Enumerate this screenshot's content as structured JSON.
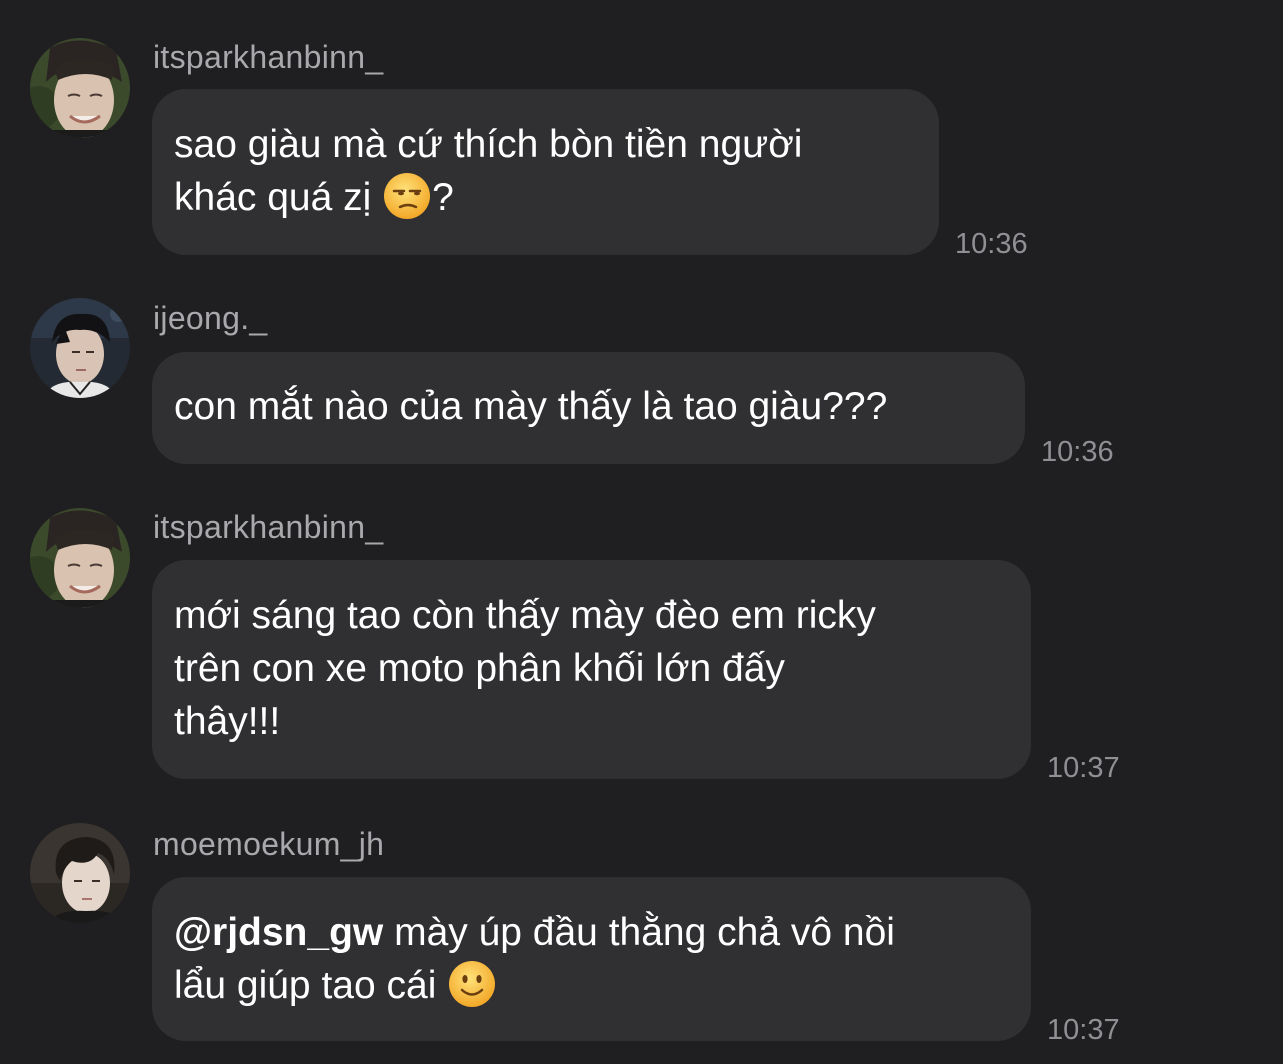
{
  "messages": [
    {
      "username": "itsparkhanbinn_",
      "avatar_icon": "profile-photo-man-smiling-icon",
      "text_lines": [
        "sao giàu mà cứ thích bòn tiền người",
        "khác quá zị"
      ],
      "text_suffix": "?",
      "emoji": "unamused-face-emoji",
      "time": "10:36"
    },
    {
      "username": "ijeong._",
      "avatar_icon": "profile-photo-man-dark-hair-icon",
      "text_lines": [
        "con mắt nào của mày thấy là tao giàu???"
      ],
      "time": "10:36"
    },
    {
      "username": "itsparkhanbinn_",
      "avatar_icon": "profile-photo-man-smiling-icon",
      "text_lines": [
        "mới sáng tao còn thấy mày đèo em ricky",
        "trên con xe moto phân khối lớn đấy",
        "thây!!!"
      ],
      "time": "10:37"
    },
    {
      "username": "moemoekum_jh",
      "avatar_icon": "profile-photo-man-tousled-hair-icon",
      "mention": "@rjdsn_gw",
      "text_lines": [
        "mày úp đầu thằng chả vô nồi",
        "lẩu giúp tao cái"
      ],
      "emoji": "slightly-smiling-face-emoji",
      "time": "10:37"
    }
  ]
}
